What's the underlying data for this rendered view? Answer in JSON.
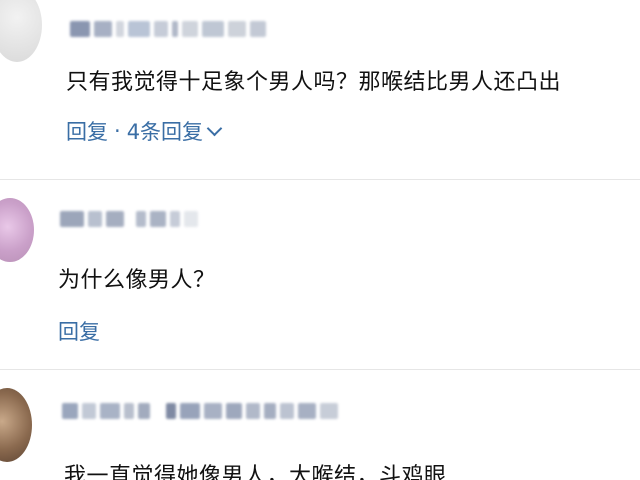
{
  "comments": [
    {
      "text": "只有我觉得十足象个男人吗？那喉结比男人还凸出",
      "reply_label": "回复",
      "separator": "·",
      "replies_count_label": "4条回复"
    },
    {
      "text": "为什么像男人？",
      "reply_label": "回复"
    },
    {
      "text": "我一直觉得她像男人，大喉结，斗鸡眼"
    }
  ],
  "colors": {
    "link": "#3a6ea5",
    "text": "#111111",
    "divider": "#e6e6e6"
  }
}
